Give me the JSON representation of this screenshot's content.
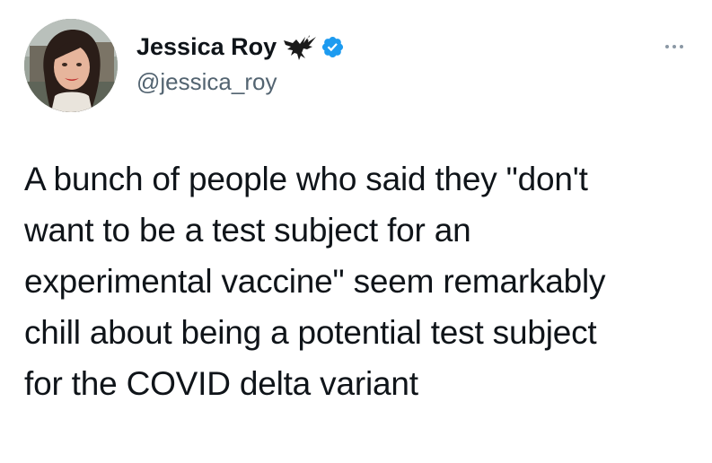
{
  "author": {
    "display_name": "Jessica Roy",
    "handle": "@jessica_roy",
    "badges": [
      "eagle-icon",
      "verified-badge-icon"
    ],
    "verified_color": "#1d9bf0"
  },
  "menu": {
    "icon": "more-options-icon"
  },
  "tweet": {
    "text": "A bunch of people who said they \"don't\nwant to be a test subject for an\nexperimental vaccine\" seem remarkably\nchill about being a potential test subject\nfor the COVID delta variant"
  }
}
